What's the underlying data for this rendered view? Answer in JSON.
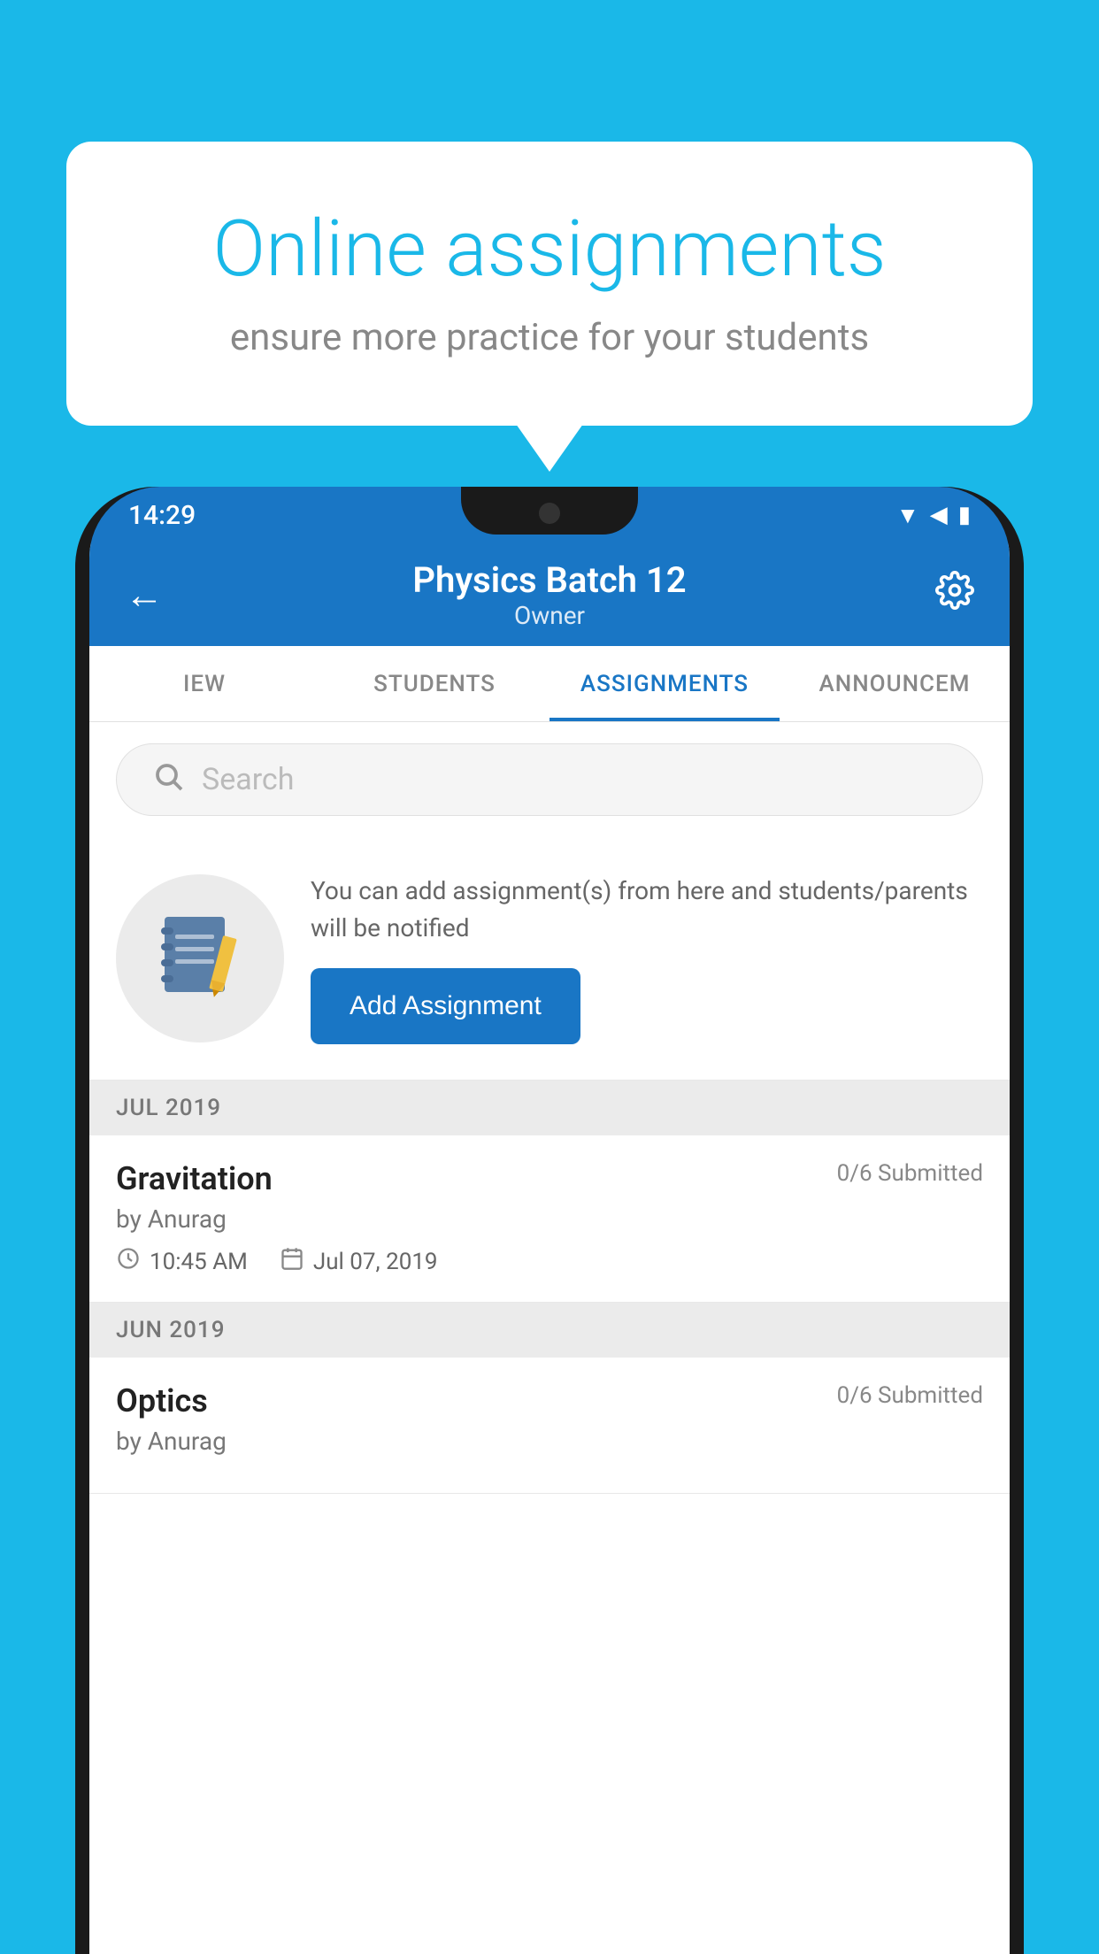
{
  "background_color": "#1ab8e8",
  "speech_bubble": {
    "title": "Online assignments",
    "subtitle": "ensure more practice for your students"
  },
  "phone": {
    "status_bar": {
      "time": "14:29",
      "icons": [
        "wifi",
        "signal",
        "battery"
      ]
    },
    "header": {
      "title": "Physics Batch 12",
      "subtitle": "Owner",
      "back_label": "←",
      "settings_label": "⚙"
    },
    "tabs": [
      {
        "label": "IEW",
        "active": false
      },
      {
        "label": "STUDENTS",
        "active": false
      },
      {
        "label": "ASSIGNMENTS",
        "active": true
      },
      {
        "label": "ANNOUNCEM",
        "active": false
      }
    ],
    "search": {
      "placeholder": "Search"
    },
    "promo": {
      "text": "You can add assignment(s) from here and students/parents will be notified",
      "button_label": "Add Assignment"
    },
    "sections": [
      {
        "month": "JUL 2019",
        "assignments": [
          {
            "title": "Gravitation",
            "status": "0/6 Submitted",
            "author": "by Anurag",
            "time": "10:45 AM",
            "date": "Jul 07, 2019"
          }
        ]
      },
      {
        "month": "JUN 2019",
        "assignments": [
          {
            "title": "Optics",
            "status": "0/6 Submitted",
            "author": "by Anurag",
            "time": "",
            "date": ""
          }
        ]
      }
    ]
  }
}
